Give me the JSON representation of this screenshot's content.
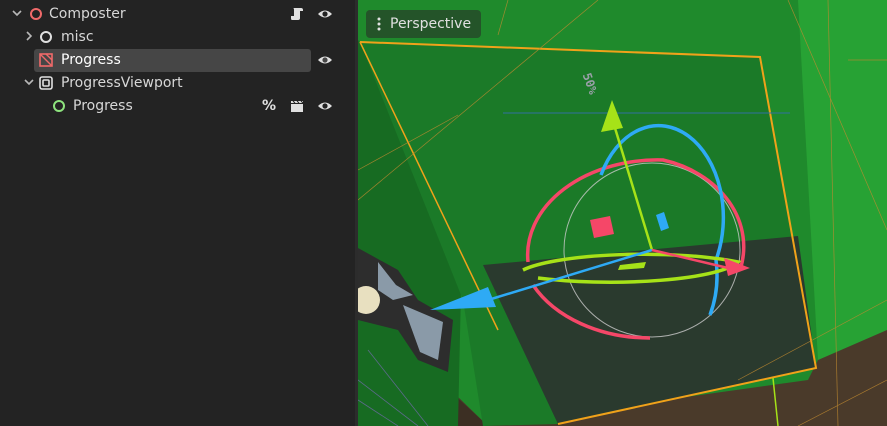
{
  "scene_tree": {
    "rows": [
      {
        "label": "Composter"
      },
      {
        "label": "misc"
      },
      {
        "label": "Progress"
      },
      {
        "label": "ProgressViewport"
      },
      {
        "label": "Progress"
      }
    ],
    "percent_label": "%"
  },
  "viewport": {
    "view_menu_label": "Perspective",
    "texture_text": "50%"
  },
  "colors": {
    "node_red": "#f06a6a",
    "node_white": "#e0e0e0",
    "node_green": "#8ee37e",
    "selection_bg": "#464646",
    "gizmo_x": "#f54768",
    "gizmo_y": "#a6e218",
    "gizmo_z": "#2eaaf5"
  }
}
